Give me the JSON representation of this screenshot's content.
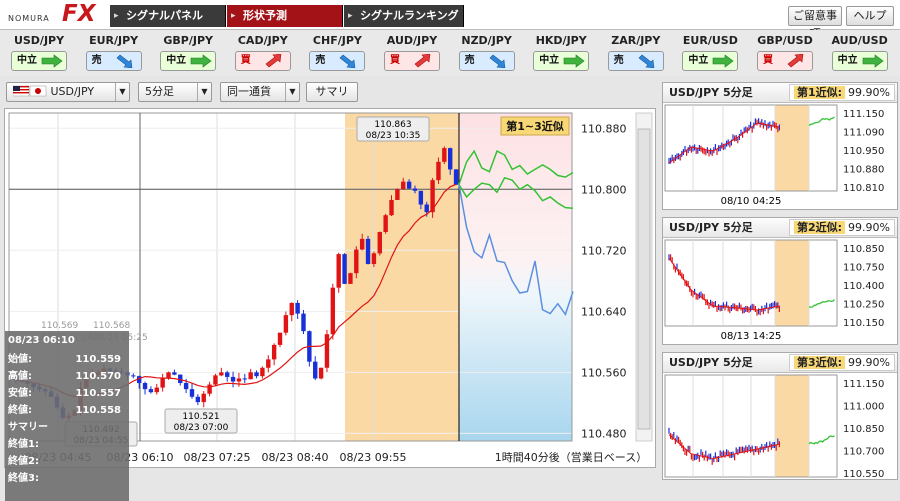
{
  "header": {
    "logo_small": "NOMURA",
    "logo_big": "FX",
    "nav": [
      "シグナルパネル",
      "形状予測",
      "シグナルランキング"
    ],
    "notice_btn": "ご留意事項",
    "help_btn": "ヘルプ"
  },
  "pairs": [
    {
      "name": "USD/JPY",
      "signal": "中立",
      "kind": "neutral"
    },
    {
      "name": "EUR/JPY",
      "signal": "売",
      "kind": "sell"
    },
    {
      "name": "GBP/JPY",
      "signal": "中立",
      "kind": "neutral"
    },
    {
      "name": "CAD/JPY",
      "signal": "買",
      "kind": "buy"
    },
    {
      "name": "CHF/JPY",
      "signal": "売",
      "kind": "sell"
    },
    {
      "name": "AUD/JPY",
      "signal": "買",
      "kind": "buy"
    },
    {
      "name": "NZD/JPY",
      "signal": "売",
      "kind": "sell"
    },
    {
      "name": "HKD/JPY",
      "signal": "中立",
      "kind": "neutral"
    },
    {
      "name": "ZAR/JPY",
      "signal": "売",
      "kind": "sell"
    },
    {
      "name": "EUR/USD",
      "signal": "中立",
      "kind": "neutral"
    },
    {
      "name": "GBP/USD",
      "signal": "買",
      "kind": "buy"
    },
    {
      "name": "AUD/USD",
      "signal": "中立",
      "kind": "neutral"
    }
  ],
  "toolbar": {
    "pair": "USD/JPY",
    "interval": "5分足",
    "currency_opt": "同一通貨",
    "summary_btn": "サマリ"
  },
  "chart_data": {
    "type": "candlestick",
    "y_ticks": [
      "110.880",
      "110.800",
      "110.720",
      "110.640",
      "110.560",
      "110.480"
    ],
    "x_ticks": [
      "08/23 04:45",
      "08/23 06:10",
      "08/23 07:25",
      "08/23 08:40",
      "08/23 09:55"
    ],
    "similar_label": "第1~3近似",
    "footer_note": "1時間40分後（営業日ベース）",
    "ann_high": {
      "value": "110.863",
      "time": "08/23 10:35"
    },
    "ann_low1": {
      "value": "110.492",
      "time": "08/23 04:55"
    },
    "ann_low2": {
      "value": "110.521",
      "time": "08/23 07:00"
    },
    "ghost": [
      "110.569",
      "110.568",
      "08/23 0□:40",
      "08/23 05:25"
    ],
    "crosshair": 110.8
  },
  "ohlc_panel": {
    "time": "08/23 06:10",
    "rows": [
      [
        "始値:",
        "110.559"
      ],
      [
        "高値:",
        "110.570"
      ],
      [
        "安値:",
        "110.557"
      ],
      [
        "終値:",
        "110.558"
      ]
    ],
    "summary": "サマリー",
    "ends": [
      "終値1:",
      "終値2:",
      "終値3:"
    ]
  },
  "similar": [
    {
      "title": "USD/JPY 5分足",
      "rank": "第1近似:",
      "pct": "99.90%",
      "yt": [
        "111.150",
        "111.090",
        "110.950",
        "110.880",
        "110.810"
      ],
      "date": "08/10 04:25"
    },
    {
      "title": "USD/JPY 5分足",
      "rank": "第2近似:",
      "pct": "99.90%",
      "yt": [
        "110.850",
        "110.750",
        "110.400",
        "110.250",
        "110.150"
      ],
      "date": "08/13 14:25"
    },
    {
      "title": "USD/JPY 5分足",
      "rank": "第3近似:",
      "pct": "99.90%",
      "yt": [
        "111.150",
        "111.000",
        "110.850",
        "110.700",
        "110.550"
      ],
      "date": ""
    }
  ]
}
